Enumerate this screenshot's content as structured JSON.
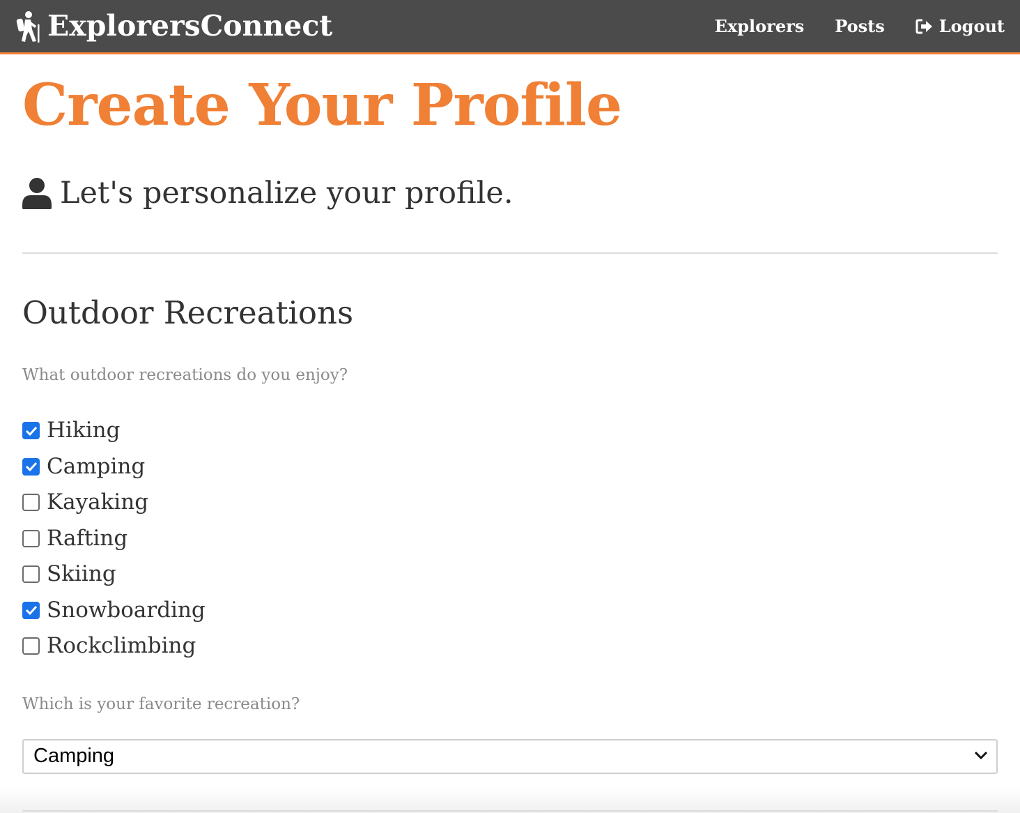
{
  "navbar": {
    "brand": "ExplorersConnect",
    "brand_icon": "hiker-icon",
    "links": {
      "explorers": "Explorers",
      "posts": "Posts",
      "logout": "Logout"
    },
    "colors": {
      "background": "#4b4b4b",
      "accent": "#f08035"
    }
  },
  "main": {
    "title": "Create Your Profile",
    "subtitle": "Let's personalize your profile.",
    "subtitle_icon": "user-icon",
    "section_title": "Outdoor Recreations",
    "question_recreations": "What outdoor recreations do you enjoy?",
    "recreations": [
      {
        "label": "Hiking",
        "checked": true
      },
      {
        "label": "Camping",
        "checked": true
      },
      {
        "label": "Kayaking",
        "checked": false
      },
      {
        "label": "Rafting",
        "checked": false
      },
      {
        "label": "Skiing",
        "checked": false
      },
      {
        "label": "Snowboarding",
        "checked": true
      },
      {
        "label": "Rockclimbing",
        "checked": false
      }
    ],
    "question_favorite": "Which is your favorite recreation?",
    "favorite_selected": "Camping"
  },
  "colors": {
    "title": "#f08035",
    "checkbox_checked": "#1a73e8",
    "muted_text": "#8a8a8a"
  }
}
